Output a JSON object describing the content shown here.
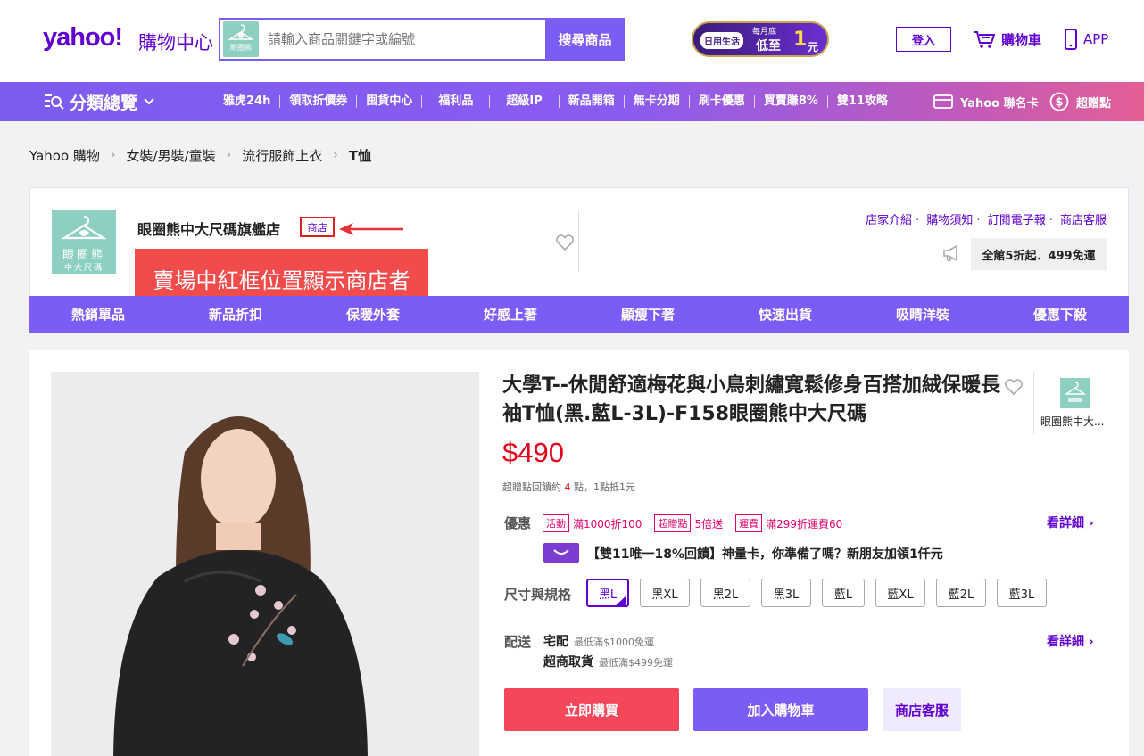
{
  "header": {
    "logo": "yahoo!",
    "logo_suffix": "購物中心",
    "search_placeholder": "請輸入商品關鍵字或編號",
    "search_thumb_text": "眼圈熊",
    "search_button": "搜尋商品",
    "promo": {
      "tag": "日用生活",
      "line1": "每月底",
      "line2": "低至",
      "big": "1",
      "unit": "元"
    },
    "login_label": "登入",
    "cart_label": "購物車",
    "app_label": "APP"
  },
  "nav": {
    "category_label": "分類總覽",
    "links": [
      "雅虎24h",
      "領取折價券",
      "囤貨中心",
      "福利品",
      "超級IP",
      "新品開箱",
      "無卡分期",
      "刷卡優惠",
      "買賣賺8%",
      "雙11攻略"
    ],
    "card_label": "Yahoo 聯名卡",
    "bonus_label": "超贈點"
  },
  "breadcrumb": [
    "Yahoo 購物",
    "女裝/男裝/童裝",
    "流行服飾上衣",
    "T恤"
  ],
  "store": {
    "logo_line1": "眼圈熊",
    "logo_line2": "中大尺碼",
    "name": "眼圈熊中大尺碼旗艦店",
    "type_badge": "商店",
    "annotation": "賣場中紅框位置顯示商店者",
    "links": [
      "店家介紹",
      "購物須知",
      "訂閱電子報",
      "商店客服"
    ],
    "promo": "全館5折起．499免運",
    "tabs": [
      "熱銷單品",
      "新品折扣",
      "保暖外套",
      "好感上著",
      "顯瘦下著",
      "快速出貨",
      "吸睛洋裝",
      "優惠下殺"
    ]
  },
  "product": {
    "title": "大學T--休閒舒適梅花與小鳥刺繡寬鬆修身百搭加絨保暖長袖T恤(黑.藍L-3L)-F158眼圈熊中大尺碼",
    "seller_name": "眼圈熊中大...",
    "price": "$490",
    "points_prefix": "超贈點回饋約",
    "points_value": "4",
    "points_suffix": "點，1點抵1元",
    "offer_label": "優惠",
    "offers": [
      {
        "tag": "活動",
        "text": "滿1000折100"
      },
      {
        "tag": "超贈點",
        "text": "5倍送"
      },
      {
        "tag": "運費",
        "text": "滿299折運費60"
      }
    ],
    "detail_label": "看詳細",
    "card_promo": "【雙11唯一18%回饋】神量卡，你準備了嗎？新朋友加領1仟元",
    "size_label": "尺寸與規格",
    "sizes": [
      "黑L",
      "黑XL",
      "黑2L",
      "黑3L",
      "藍L",
      "藍XL",
      "藍2L",
      "藍3L"
    ],
    "selected_size": "黑L",
    "ship_label": "配送",
    "ship_home": "宅配",
    "ship_home_note": "最低滿$1000免運",
    "ship_store": "超商取貨",
    "ship_store_note": "最低滿$499免運",
    "buy_now": "立即購買",
    "add_to_cart": "加入購物車",
    "store_service": "商店客服"
  },
  "colors": {
    "brand": "#6001d2",
    "accent": "#7b5cf5",
    "price": "#e6001a",
    "buy": "#f5475a",
    "annotation": "#f24b4b",
    "store_logo": "#8dcfc0"
  }
}
